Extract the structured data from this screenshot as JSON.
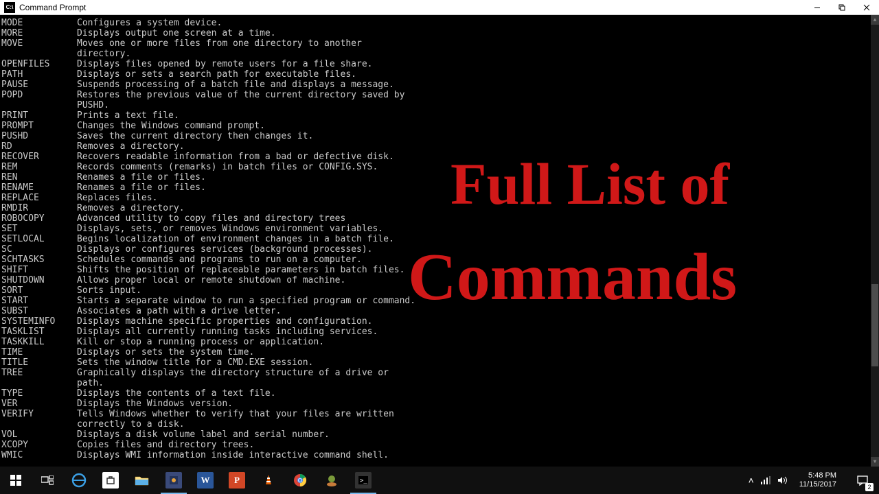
{
  "window": {
    "title": "Command Prompt",
    "icon_label": "C:\\"
  },
  "overlay": {
    "line1": "Full List of",
    "line2": "Commands"
  },
  "commands": [
    {
      "name": "MODE",
      "desc": "Configures a system device."
    },
    {
      "name": "MORE",
      "desc": "Displays output one screen at a time."
    },
    {
      "name": "MOVE",
      "desc": "Moves one or more files from one directory to another"
    },
    {
      "name": "",
      "desc": "directory."
    },
    {
      "name": "OPENFILES",
      "desc": "Displays files opened by remote users for a file share."
    },
    {
      "name": "PATH",
      "desc": "Displays or sets a search path for executable files."
    },
    {
      "name": "PAUSE",
      "desc": "Suspends processing of a batch file and displays a message."
    },
    {
      "name": "POPD",
      "desc": "Restores the previous value of the current directory saved by"
    },
    {
      "name": "",
      "desc": "PUSHD."
    },
    {
      "name": "PRINT",
      "desc": "Prints a text file."
    },
    {
      "name": "PROMPT",
      "desc": "Changes the Windows command prompt."
    },
    {
      "name": "PUSHD",
      "desc": "Saves the current directory then changes it."
    },
    {
      "name": "RD",
      "desc": "Removes a directory."
    },
    {
      "name": "RECOVER",
      "desc": "Recovers readable information from a bad or defective disk."
    },
    {
      "name": "REM",
      "desc": "Records comments (remarks) in batch files or CONFIG.SYS."
    },
    {
      "name": "REN",
      "desc": "Renames a file or files."
    },
    {
      "name": "RENAME",
      "desc": "Renames a file or files."
    },
    {
      "name": "REPLACE",
      "desc": "Replaces files."
    },
    {
      "name": "RMDIR",
      "desc": "Removes a directory."
    },
    {
      "name": "ROBOCOPY",
      "desc": "Advanced utility to copy files and directory trees"
    },
    {
      "name": "SET",
      "desc": "Displays, sets, or removes Windows environment variables."
    },
    {
      "name": "SETLOCAL",
      "desc": "Begins localization of environment changes in a batch file."
    },
    {
      "name": "SC",
      "desc": "Displays or configures services (background processes)."
    },
    {
      "name": "SCHTASKS",
      "desc": "Schedules commands and programs to run on a computer."
    },
    {
      "name": "SHIFT",
      "desc": "Shifts the position of replaceable parameters in batch files."
    },
    {
      "name": "SHUTDOWN",
      "desc": "Allows proper local or remote shutdown of machine."
    },
    {
      "name": "SORT",
      "desc": "Sorts input."
    },
    {
      "name": "START",
      "desc": "Starts a separate window to run a specified program or command."
    },
    {
      "name": "SUBST",
      "desc": "Associates a path with a drive letter."
    },
    {
      "name": "SYSTEMINFO",
      "desc": "Displays machine specific properties and configuration."
    },
    {
      "name": "TASKLIST",
      "desc": "Displays all currently running tasks including services."
    },
    {
      "name": "TASKKILL",
      "desc": "Kill or stop a running process or application."
    },
    {
      "name": "TIME",
      "desc": "Displays or sets the system time."
    },
    {
      "name": "TITLE",
      "desc": "Sets the window title for a CMD.EXE session."
    },
    {
      "name": "TREE",
      "desc": "Graphically displays the directory structure of a drive or"
    },
    {
      "name": "",
      "desc": "path."
    },
    {
      "name": "TYPE",
      "desc": "Displays the contents of a text file."
    },
    {
      "name": "VER",
      "desc": "Displays the Windows version."
    },
    {
      "name": "VERIFY",
      "desc": "Tells Windows whether to verify that your files are written"
    },
    {
      "name": "",
      "desc": "correctly to a disk."
    },
    {
      "name": "VOL",
      "desc": "Displays a disk volume label and serial number."
    },
    {
      "name": "XCOPY",
      "desc": "Copies files and directory trees."
    },
    {
      "name": "WMIC",
      "desc": "Displays WMI information inside interactive command shell."
    }
  ],
  "systray": {
    "time": "5:48 PM",
    "date": "11/15/2017",
    "notification_count": "2"
  }
}
